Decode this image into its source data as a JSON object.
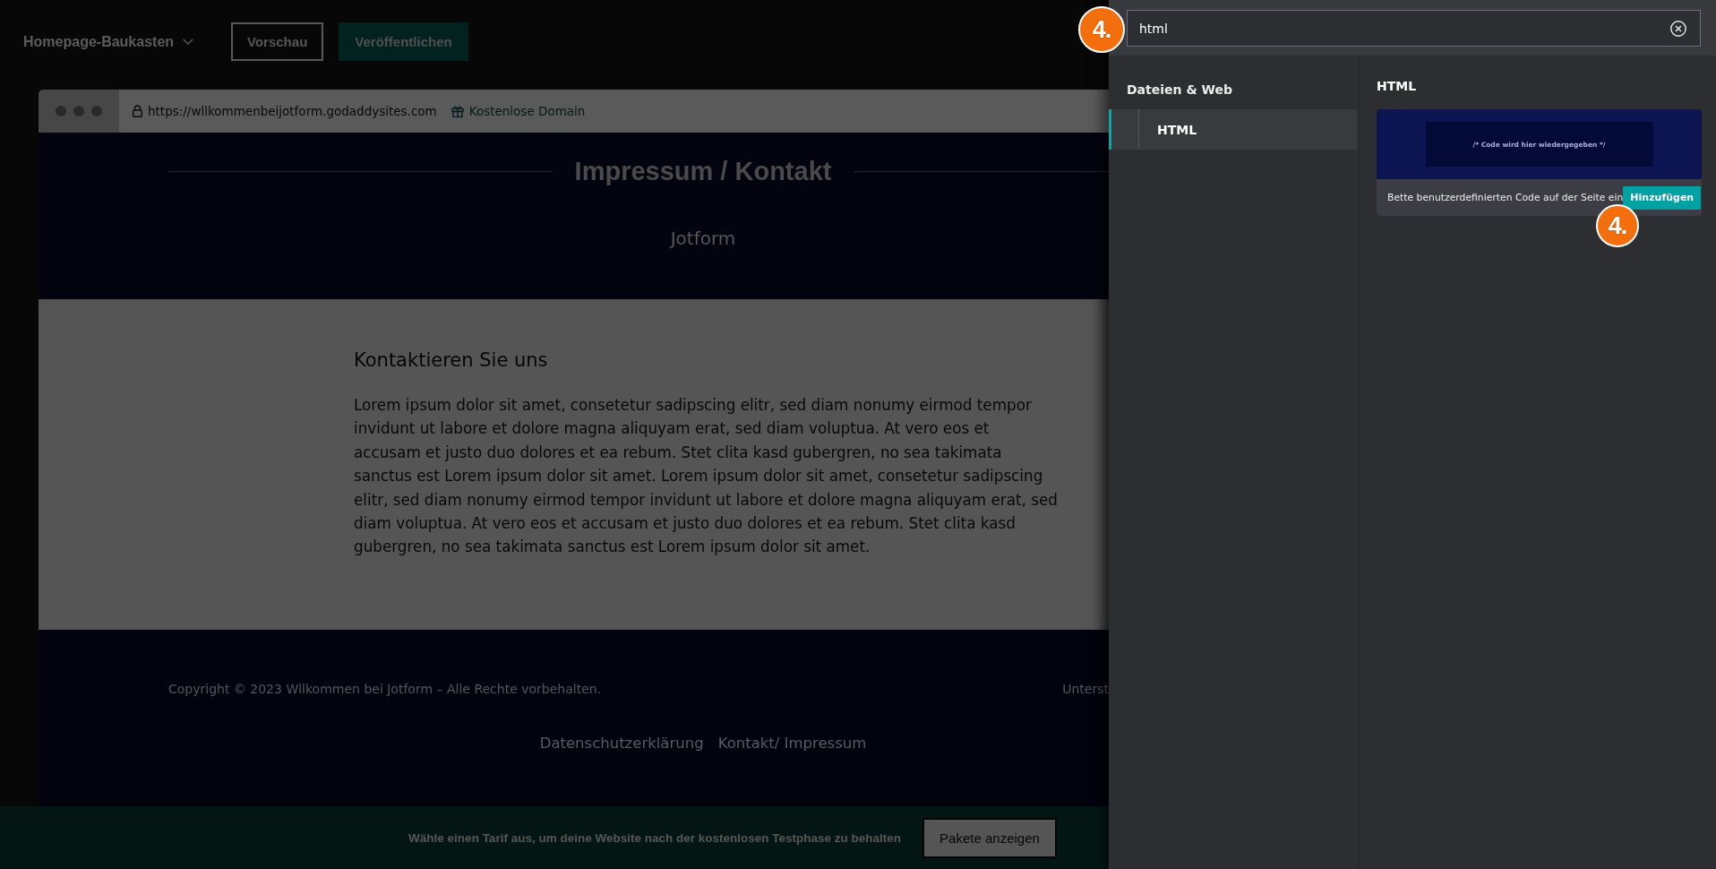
{
  "header": {
    "title": "Homepage-Baukasten",
    "buttons": [
      {
        "label": "Vorschau",
        "kind": "outline"
      },
      {
        "label": "Veröffentlichen",
        "kind": "primary"
      }
    ]
  },
  "browser": {
    "url": "https://wllkommenbeijotform.godaddysites.com",
    "domain_link": "Kostenlose Domain"
  },
  "site": {
    "hero": {
      "title": "Impressum / Kontakt",
      "subtitle": "Jotform"
    },
    "content": {
      "heading": "Kontaktieren Sie uns",
      "text": "Lorem ipsum dolor sit amet, consetetur sadipscing elitr, sed diam nonumy eirmod tempor invidunt ut labore et dolore magna aliquyam erat, sed diam voluptua. At vero eos et accusam et justo duo dolores et ea rebum. Stet clita kasd gubergren, no sea takimata sanctus est Lorem ipsum dolor sit amet. Lorem ipsum dolor sit amet, consetetur sadipscing elitr, sed diam nonumy eirmod tempor invidunt ut labore et dolore magna aliquyam erat, sed diam voluptua. At vero eos et accusam et justo duo dolores et ea rebum. Stet clita kasd gubergren, no sea takimata sanctus est Lorem ipsum dolor sit amet."
    },
    "footer": {
      "copyright": "Copyright © 2023 Wllkommen bei Jotform – Alle Rechte vorbehalten.",
      "column_2": "Unterst",
      "links": [
        "Datenschutzerklärung",
        "Kontakt/ Impressum"
      ]
    }
  },
  "trial_bar": {
    "text": "Wähle einen Tarif aus, um deine Website nach der kostenlosen Testphase zu behalten",
    "button": "Pakete anzeigen"
  },
  "panel": {
    "search": {
      "value": "html",
      "step_badge": "4."
    },
    "categories": [
      {
        "label": "Dateien & Web",
        "children": [
          {
            "label": "HTML",
            "selected": true
          }
        ]
      }
    ],
    "section_title": "HTML",
    "cards": [
      {
        "preview_code": "/* Code wird hier wiedergegeben */",
        "description": "Bette benutzerdefinierten Code auf der Seite ein",
        "button": "Hinzufügen",
        "step_badge": "4."
      }
    ]
  }
}
